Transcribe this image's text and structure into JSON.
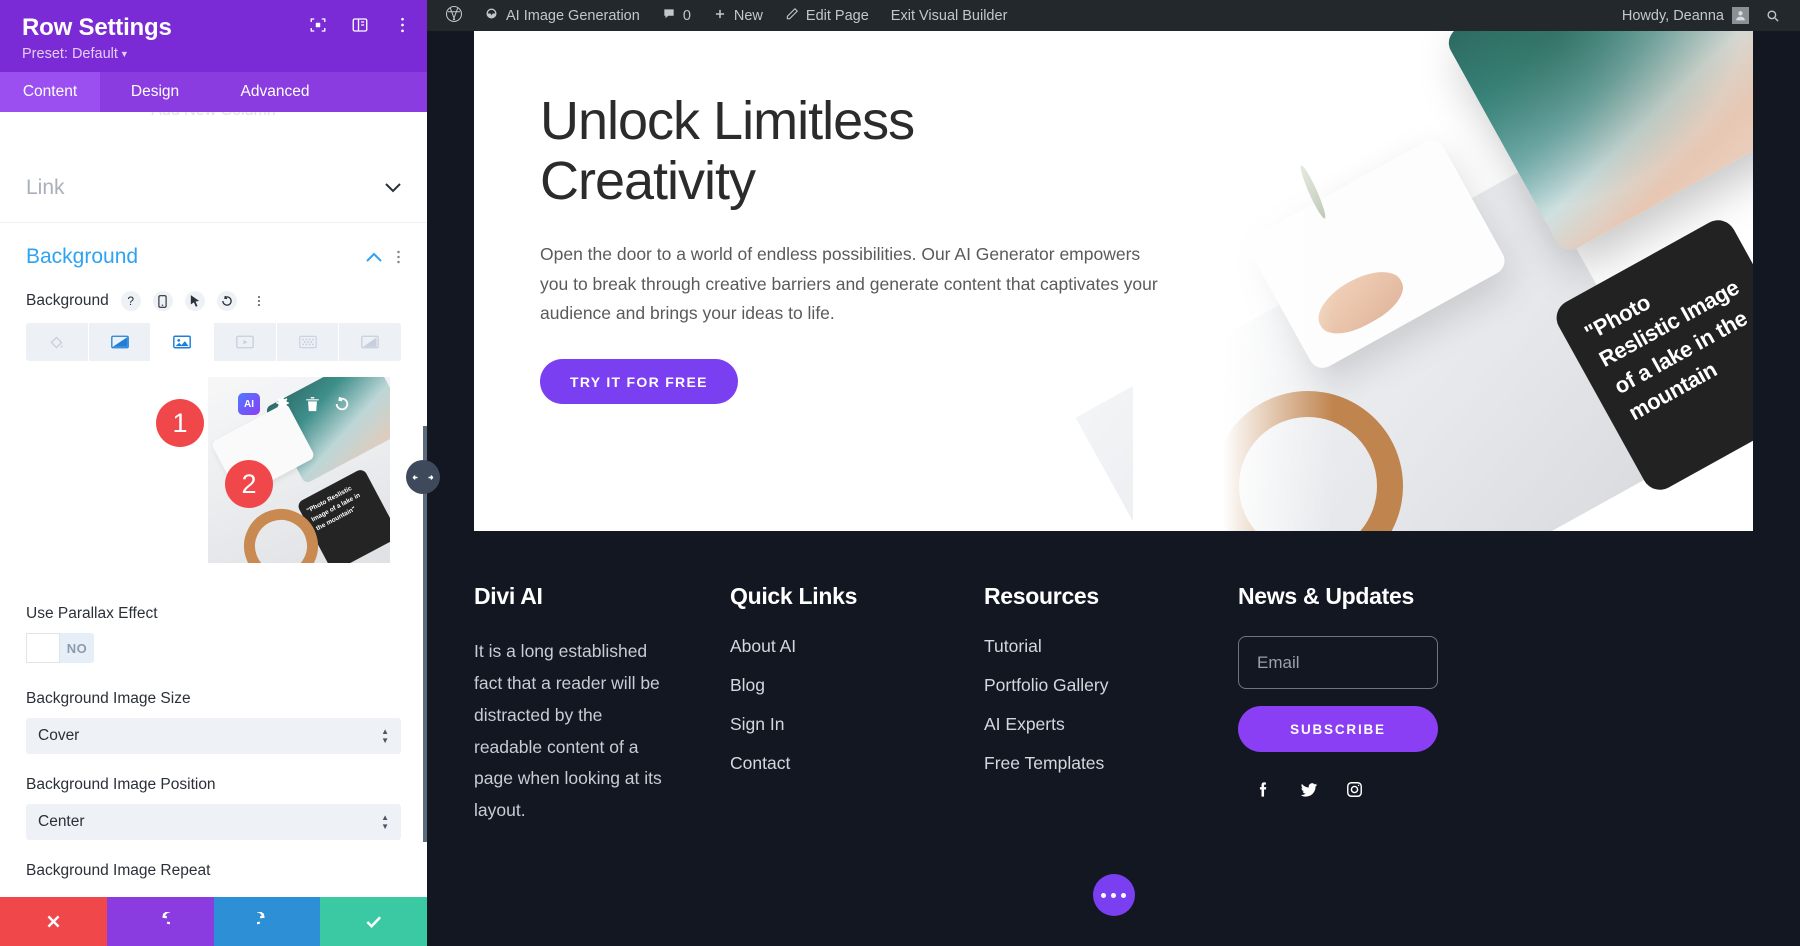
{
  "panel": {
    "title": "Row Settings",
    "preset": "Preset: Default",
    "header_icons": [
      "focus-icon",
      "layout-icon",
      "more-vertical-icon"
    ],
    "tabs": [
      {
        "label": "Content",
        "active": true
      },
      {
        "label": "Design",
        "active": false
      },
      {
        "label": "Advanced",
        "active": false
      }
    ],
    "ghost_text": "Add New Column",
    "accordions": [
      {
        "label": "Link",
        "state": "collapsed",
        "icon": "chevron-down-icon"
      },
      {
        "label": "Background",
        "state": "expanded",
        "icon": "chevron-up-icon"
      }
    ],
    "background": {
      "label": "Background",
      "control_icons": [
        "help-icon",
        "mobile-icon",
        "cursor-icon",
        "reset-icon",
        "more-vertical-icon"
      ],
      "types": [
        {
          "name": "background-color",
          "active": false
        },
        {
          "name": "background-gradient",
          "active": false
        },
        {
          "name": "background-image",
          "active": true
        },
        {
          "name": "background-video",
          "active": false
        },
        {
          "name": "background-pattern",
          "active": false
        },
        {
          "name": "background-mask",
          "active": false
        }
      ],
      "preview_tools": [
        "ai-badge",
        "gear-icon",
        "trash-icon",
        "reset-icon"
      ],
      "ai_badge_text": "AI",
      "preview_caption": "\"Photo Reslistic Image of a lake in the mountain\"",
      "callouts": [
        {
          "number": "1"
        },
        {
          "number": "2"
        }
      ]
    },
    "fields": [
      {
        "label": "Use Parallax Effect",
        "type": "toggle",
        "value": "NO"
      },
      {
        "label": "Background Image Size",
        "type": "select",
        "value": "Cover"
      },
      {
        "label": "Background Image Position",
        "type": "select",
        "value": "Center"
      },
      {
        "label": "Background Image Repeat",
        "type": "label-only",
        "value": ""
      }
    ],
    "footer_buttons": [
      {
        "name": "discard-button",
        "icon": "close-icon",
        "color": "#f0474b"
      },
      {
        "name": "undo-button",
        "icon": "undo-icon",
        "color": "#8b3ce0"
      },
      {
        "name": "redo-button",
        "icon": "redo-icon",
        "color": "#2d8fd5"
      },
      {
        "name": "save-button",
        "icon": "check-icon",
        "color": "#3bc9a4"
      }
    ]
  },
  "adminbar": {
    "items": [
      {
        "label": "",
        "icon": "wordpress-logo-icon"
      },
      {
        "label": "AI Image Generation",
        "icon": "site-icon"
      },
      {
        "label": "0",
        "icon": "comment-icon"
      },
      {
        "label": "New",
        "icon": "plus-icon"
      },
      {
        "label": "Edit Page",
        "icon": "pencil-icon"
      },
      {
        "label": "Exit Visual Builder",
        "icon": ""
      }
    ],
    "howdy": "Howdy, Deanna",
    "search_icon": "search-icon"
  },
  "hero": {
    "heading": "Unlock Limitless Creativity",
    "paragraph": "Open the door to a world of endless possibilities. Our AI Generator empowers you to break through creative barriers and generate content that captivates your audience and brings your ideas to life.",
    "cta": "TRY IT FOR FREE",
    "art_caption": "\"Photo Reslistic Image of a lake in the mountain"
  },
  "footer": {
    "col1": {
      "heading": "Divi AI",
      "body": "It is a long established fact that a reader will be distracted by the readable content of a page when looking at its layout."
    },
    "col2": {
      "heading": "Quick Links",
      "links": [
        "About AI",
        "Blog",
        "Sign In",
        "Contact"
      ]
    },
    "col3": {
      "heading": "Resources",
      "links": [
        "Tutorial",
        "Portfolio Gallery",
        "AI Experts",
        "Free Templates"
      ]
    },
    "col4": {
      "heading": "News & Updates",
      "email_placeholder": "Email",
      "email_value": "",
      "subscribe": "SUBSCRIBE",
      "socials": [
        "facebook-icon",
        "twitter-icon",
        "instagram-icon"
      ]
    }
  },
  "fab": {
    "name": "divi-menu-button",
    "icon": "ellipsis-icon"
  },
  "colors": {
    "panel_header": "#7b2bd6",
    "tab_active": "#9b4ff0",
    "accent_blue": "#2ea3f2",
    "cta_purple": "#7b3ff2",
    "callout_red": "#f0474b",
    "footer_bg": "#121722",
    "adminbar_bg": "#23282d"
  }
}
